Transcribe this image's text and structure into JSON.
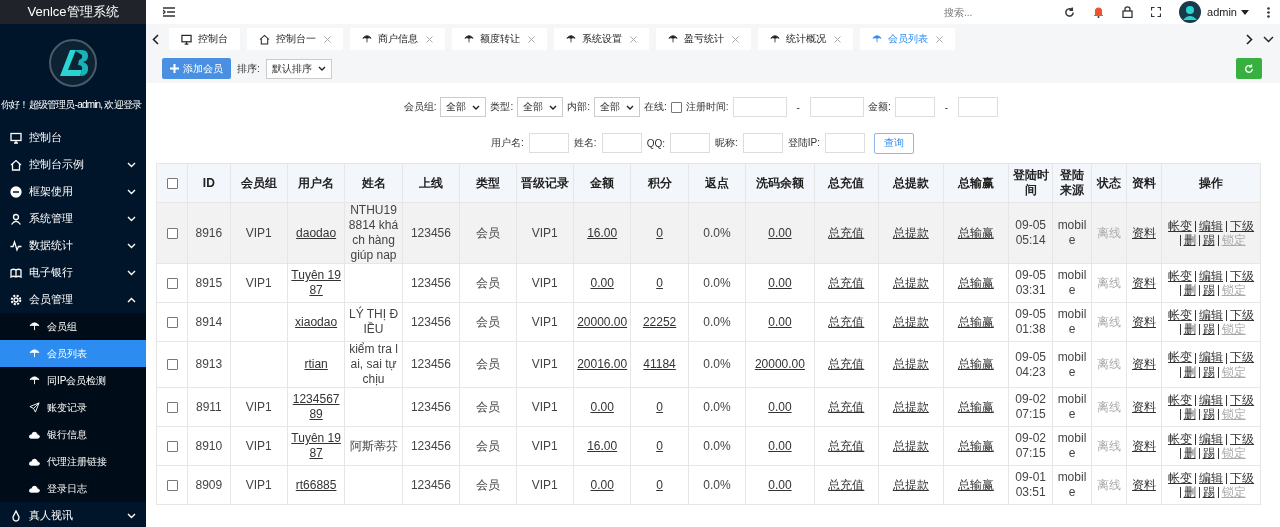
{
  "sidebar": {
    "title": "Venlce管理系统",
    "greeting": "你好！超级管理员-admin, 欢迎登录",
    "items": [
      {
        "label": "控制台",
        "kind": "link"
      },
      {
        "label": "控制台示例",
        "kind": "group",
        "expanded": false
      },
      {
        "label": "框架使用",
        "kind": "group",
        "expanded": false
      },
      {
        "label": "系统管理",
        "kind": "group",
        "expanded": false
      },
      {
        "label": "数据统计",
        "kind": "group",
        "expanded": false
      },
      {
        "label": "电子银行",
        "kind": "group",
        "expanded": false
      },
      {
        "label": "会员管理",
        "kind": "group",
        "expanded": true,
        "children": [
          {
            "label": "会员组",
            "selected": false
          },
          {
            "label": "会员列表",
            "selected": true
          },
          {
            "label": "同IP会员检测",
            "selected": false
          },
          {
            "label": "账变记录",
            "selected": false
          },
          {
            "label": "银行信息",
            "selected": false
          },
          {
            "label": "代理注册链接",
            "selected": false
          },
          {
            "label": "登录日志",
            "selected": false
          }
        ]
      },
      {
        "label": "真人视讯",
        "kind": "group",
        "expanded": false
      }
    ]
  },
  "topbar": {
    "search_placeholder": "搜索...",
    "user": "admin"
  },
  "tabs": [
    {
      "label": "控制台",
      "selected": false,
      "closable": false
    },
    {
      "label": "控制台一",
      "selected": false,
      "closable": true
    },
    {
      "label": "商户信息",
      "selected": false,
      "closable": true
    },
    {
      "label": "额度转让",
      "selected": false,
      "closable": true
    },
    {
      "label": "系统设置",
      "selected": false,
      "closable": true
    },
    {
      "label": "盈亏统计",
      "selected": false,
      "closable": true
    },
    {
      "label": "统计概况",
      "selected": false,
      "closable": true
    },
    {
      "label": "会员列表",
      "selected": true,
      "closable": true
    }
  ],
  "toolbar": {
    "add_button": "添加会员",
    "sort_label": "排序:",
    "sort_value": "默认排序"
  },
  "filters": [
    [
      {
        "kind": "select",
        "label": "会员组:",
        "value": "全部"
      },
      {
        "kind": "select",
        "label": "类型:",
        "value": "全部"
      },
      {
        "kind": "select",
        "label": "内部:",
        "value": "全部"
      },
      {
        "kind": "checkbox",
        "label": "在线:",
        "checked": false
      },
      {
        "kind": "range",
        "label": "注册时间:",
        "separator": "-"
      },
      {
        "kind": "range",
        "label": "金额:",
        "separator": "-"
      }
    ],
    [
      {
        "kind": "input",
        "label": "用户名:"
      },
      {
        "kind": "input",
        "label": "姓名:"
      },
      {
        "kind": "input",
        "label": "QQ:"
      },
      {
        "kind": "input",
        "label": "昵称:"
      },
      {
        "kind": "input",
        "label": "登陆IP:"
      },
      {
        "kind": "button",
        "label": "查询"
      }
    ]
  ],
  "table": {
    "all_checked": false,
    "columns": [
      "ID",
      "会员组",
      "用户名",
      "姓名",
      "上线",
      "类型",
      "晋级记录",
      "金额",
      "积分",
      "返点",
      "洗码余额",
      "总充值",
      "总提款",
      "总输赢",
      "登陆时间",
      "登陆来源",
      "状态",
      "资料",
      "操作"
    ],
    "rows": [
      {
        "selected": true,
        "checked": false,
        "cells": [
          "8916",
          "VIP1",
          "daodao",
          "NTHU198814 khách hàng giúp nap",
          "123456",
          "会员",
          "VIP1",
          "16.00",
          "0",
          "0.0%",
          "0.00",
          "总充值",
          "总提款",
          "总输赢",
          "09-05 05:14",
          "mobile",
          "离线",
          "资料"
        ],
        "ops": [
          {
            "label": "帐变",
            "disabled": false
          },
          {
            "label": "编辑",
            "disabled": false
          },
          {
            "label": "下级",
            "disabled": false
          },
          {
            "label": "删",
            "disabled": false
          },
          {
            "label": "踢",
            "disabled": false
          },
          {
            "label": "锁定",
            "disabled": true
          }
        ]
      },
      {
        "selected": false,
        "checked": false,
        "cells": [
          "8915",
          "VIP1",
          "Tuyên 1987",
          "",
          "123456",
          "会员",
          "VIP1",
          "0.00",
          "0",
          "0.0%",
          "0.00",
          "总充值",
          "总提款",
          "总输赢",
          "09-05 03:31",
          "mobile",
          "离线",
          "资料"
        ],
        "ops": [
          {
            "label": "帐变",
            "disabled": false
          },
          {
            "label": "编辑",
            "disabled": false
          },
          {
            "label": "下级",
            "disabled": false
          },
          {
            "label": "删",
            "disabled": false
          },
          {
            "label": "踢",
            "disabled": false
          },
          {
            "label": "锁定",
            "disabled": true
          }
        ]
      },
      {
        "selected": false,
        "checked": false,
        "cells": [
          "8914",
          "",
          "xiaodao",
          "LÝ THỊ ĐIỀU",
          "123456",
          "会员",
          "VIP1",
          "20000.00",
          "22252",
          "0.0%",
          "0.00",
          "总充值",
          "总提款",
          "总输赢",
          "09-05 01:38",
          "mobile",
          "离线",
          "资料"
        ],
        "ops": [
          {
            "label": "帐变",
            "disabled": false
          },
          {
            "label": "编辑",
            "disabled": false
          },
          {
            "label": "下级",
            "disabled": false
          },
          {
            "label": "删",
            "disabled": false
          },
          {
            "label": "踢",
            "disabled": false
          },
          {
            "label": "锁定",
            "disabled": true
          }
        ]
      },
      {
        "selected": false,
        "checked": false,
        "cells": [
          "8913",
          "",
          "rtian",
          "kiểm tra lai, sai tự chịu",
          "123456",
          "会员",
          "VIP1",
          "20016.00",
          "41184",
          "0.0%",
          "20000.00",
          "总充值",
          "总提款",
          "总输赢",
          "09-05 04:23",
          "mobile",
          "离线",
          "资料"
        ],
        "ops": [
          {
            "label": "帐变",
            "disabled": false
          },
          {
            "label": "编辑",
            "disabled": false
          },
          {
            "label": "下级",
            "disabled": false
          },
          {
            "label": "删",
            "disabled": false
          },
          {
            "label": "踢",
            "disabled": false
          },
          {
            "label": "锁定",
            "disabled": true
          }
        ]
      },
      {
        "selected": false,
        "checked": false,
        "cells": [
          "8911",
          "VIP1",
          "123456789",
          "",
          "123456",
          "会员",
          "VIP1",
          "0.00",
          "0",
          "0.0%",
          "0.00",
          "总充值",
          "总提款",
          "总输赢",
          "09-02 07:15",
          "mobile",
          "离线",
          "资料"
        ],
        "ops": [
          {
            "label": "帐变",
            "disabled": false
          },
          {
            "label": "编辑",
            "disabled": false
          },
          {
            "label": "下级",
            "disabled": false
          },
          {
            "label": "删",
            "disabled": false
          },
          {
            "label": "踢",
            "disabled": false
          },
          {
            "label": "锁定",
            "disabled": true
          }
        ]
      },
      {
        "selected": false,
        "checked": false,
        "cells": [
          "8910",
          "VIP1",
          "Tuyên 1987",
          "阿斯蒂芬",
          "123456",
          "会员",
          "VIP1",
          "16.00",
          "0",
          "0.0%",
          "0.00",
          "总充值",
          "总提款",
          "总输赢",
          "09-02 07:15",
          "mobile",
          "离线",
          "资料"
        ],
        "ops": [
          {
            "label": "帐变",
            "disabled": false
          },
          {
            "label": "编辑",
            "disabled": false
          },
          {
            "label": "下级",
            "disabled": false
          },
          {
            "label": "删",
            "disabled": false
          },
          {
            "label": "踢",
            "disabled": false
          },
          {
            "label": "锁定",
            "disabled": true
          }
        ]
      },
      {
        "selected": false,
        "checked": false,
        "cells": [
          "8909",
          "VIP1",
          "rt66885",
          "",
          "123456",
          "会员",
          "VIP1",
          "0.00",
          "0",
          "0.0%",
          "0.00",
          "总充值",
          "总提款",
          "总输赢",
          "09-01 03:51",
          "mobile",
          "离线",
          "资料"
        ],
        "ops": [
          {
            "label": "帐变",
            "disabled": false
          },
          {
            "label": "编辑",
            "disabled": false
          },
          {
            "label": "下级",
            "disabled": false
          },
          {
            "label": "删",
            "disabled": false
          },
          {
            "label": "踢",
            "disabled": false
          },
          {
            "label": "锁定",
            "disabled": true
          }
        ]
      }
    ]
  }
}
